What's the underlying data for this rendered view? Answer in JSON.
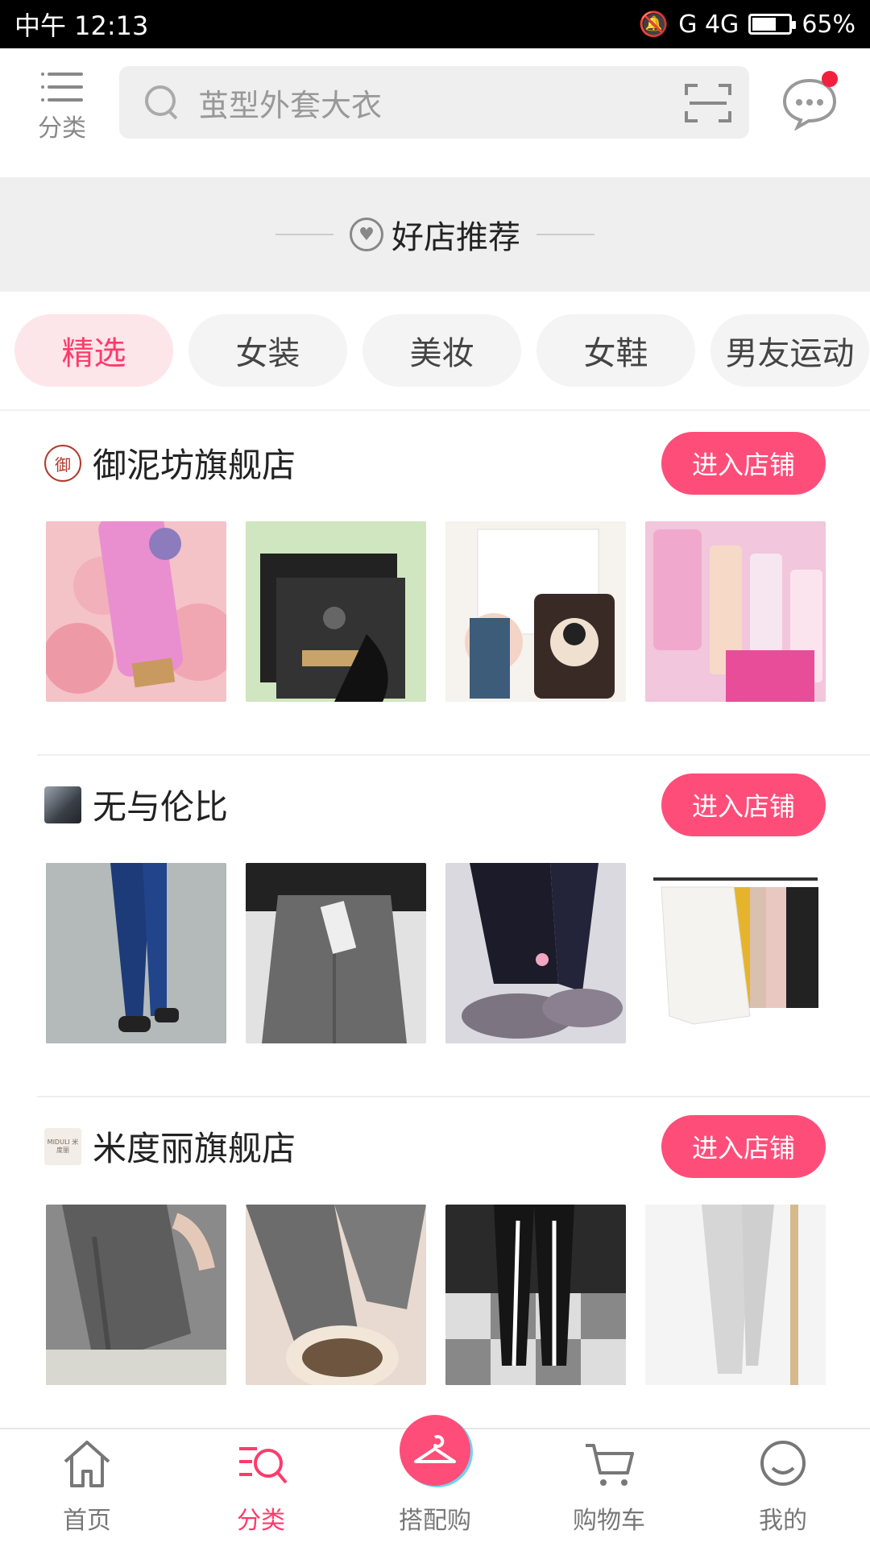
{
  "status_bar": {
    "time": "中午 12:13",
    "network": "G  4G",
    "battery_percent": "65%",
    "battery_level": 0.65
  },
  "top_bar": {
    "category_label": "分类",
    "search_placeholder": "茧型外套大衣",
    "has_unread_message": true
  },
  "banner": {
    "title": "好店推荐"
  },
  "tabs": [
    {
      "label": "精选",
      "active": true
    },
    {
      "label": "女装",
      "active": false
    },
    {
      "label": "美妆",
      "active": false
    },
    {
      "label": "女鞋",
      "active": false
    },
    {
      "label": "男友运动",
      "active": false
    }
  ],
  "stores": [
    {
      "name": "御泥坊旗舰店",
      "logo_text": "御",
      "enter_label": "进入店铺",
      "products": [
        {
          "kind": "pink-tube-roses"
        },
        {
          "kind": "black-mask-box"
        },
        {
          "kind": "white-mask-box"
        },
        {
          "kind": "pink-bottles"
        }
      ]
    },
    {
      "name": "无与伦比",
      "logo_text": "",
      "enter_label": "进入店铺",
      "products": [
        {
          "kind": "blue-jeans"
        },
        {
          "kind": "grey-wide-pants"
        },
        {
          "kind": "black-leggings-slippers"
        },
        {
          "kind": "sweaters-rack"
        }
      ]
    },
    {
      "name": "米度丽旗舰店",
      "logo_text": "MIDULI 米度丽",
      "enter_label": "进入店铺",
      "products": [
        {
          "kind": "grey-knit-leggings"
        },
        {
          "kind": "grey-leggings-boots"
        },
        {
          "kind": "black-stripe-pants"
        },
        {
          "kind": "light-grey-leggings"
        }
      ]
    }
  ],
  "bottom_nav": [
    {
      "label": "首页",
      "icon": "home-icon",
      "active": false
    },
    {
      "label": "分类",
      "icon": "category-search-icon",
      "active": true
    },
    {
      "label": "搭配购",
      "icon": "hanger-icon",
      "active": false
    },
    {
      "label": "购物车",
      "icon": "cart-icon",
      "active": false
    },
    {
      "label": "我的",
      "icon": "profile-icon",
      "active": false
    }
  ],
  "colors": {
    "accent": "#ff4d79",
    "accent_text": "#ff3b6b",
    "tab_active_bg": "#fde6ea"
  }
}
